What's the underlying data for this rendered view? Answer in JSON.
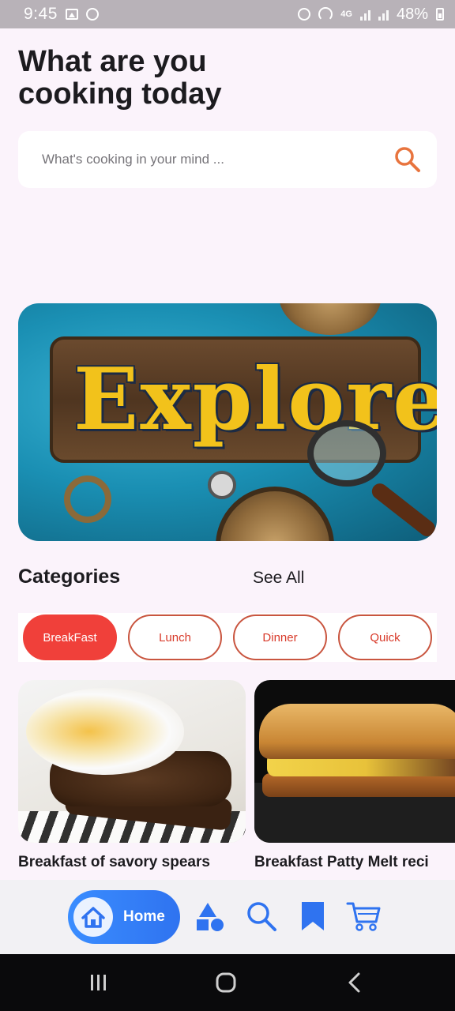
{
  "status_bar": {
    "time": "9:45",
    "network": "4G",
    "battery": "48%"
  },
  "header": {
    "title": "What are you cooking today"
  },
  "search": {
    "placeholder": "What's cooking in your mind ..."
  },
  "banner": {
    "text": "Explore"
  },
  "categories": {
    "title": "Categories",
    "see_all": "See All",
    "chips": [
      {
        "label": "BreakFast",
        "active": true
      },
      {
        "label": "Lunch",
        "active": false
      },
      {
        "label": "Dinner",
        "active": false
      },
      {
        "label": "Quick",
        "active": false
      }
    ]
  },
  "recipes": [
    {
      "name": "Breakfast of savory spears"
    },
    {
      "name": "Breakfast Patty Melt reci"
    }
  ],
  "bottom_nav": {
    "home_label": "Home",
    "icons": [
      "home-icon",
      "categories-icon",
      "search-icon",
      "bookmark-icon",
      "cart-icon"
    ]
  },
  "colors": {
    "accent_blue": "#2f73f0",
    "chip_red": "#f0403a",
    "search_orange": "#e8743e"
  }
}
